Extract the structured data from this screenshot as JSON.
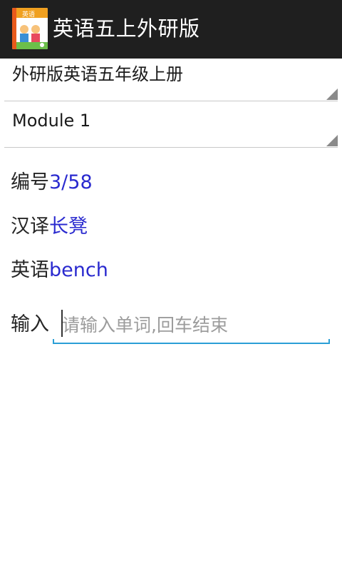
{
  "app": {
    "title": "英语五上外研版",
    "icon": "textbook-cover-icon"
  },
  "spinners": {
    "book": {
      "selected": "外研版英语五年级上册"
    },
    "module": {
      "selected": "Module 1"
    }
  },
  "word": {
    "number_label": "编号",
    "number_value": "3/58",
    "chinese_label": "汉译",
    "chinese_value": "长凳",
    "english_label": "英语",
    "english_value": "bench"
  },
  "input": {
    "label": "输入",
    "value": "",
    "placeholder": "请输入单词,回车结束"
  },
  "colors": {
    "actionbar": "#1f1f1f",
    "value_text": "#2a2acf",
    "focus_underline": "#2b9fd6"
  }
}
